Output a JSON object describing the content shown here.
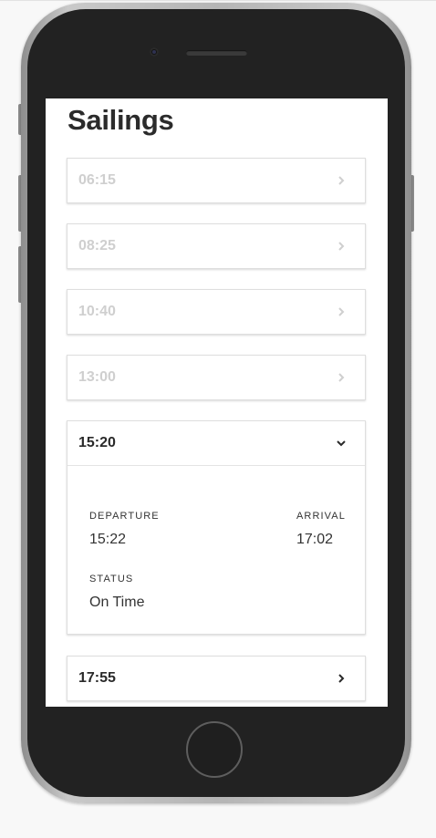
{
  "page": {
    "title": "Sailings"
  },
  "sailings": [
    {
      "time": "06:15",
      "state": "past"
    },
    {
      "time": "08:25",
      "state": "past"
    },
    {
      "time": "10:40",
      "state": "past"
    },
    {
      "time": "13:00",
      "state": "past"
    },
    {
      "time": "15:20",
      "state": "expanded"
    },
    {
      "time": "17:55",
      "state": "upcoming"
    }
  ],
  "details": {
    "departure_label": "DEPARTURE",
    "departure_value": "15:22",
    "arrival_label": "ARRIVAL",
    "arrival_value": "17:02",
    "status_label": "STATUS",
    "status_value": "On Time"
  },
  "icons": {
    "collapsed": "chevron-right-icon",
    "expanded": "chevron-down-icon"
  },
  "colors": {
    "past_text": "#cfcfcf",
    "active_text": "#2a2a2a"
  }
}
